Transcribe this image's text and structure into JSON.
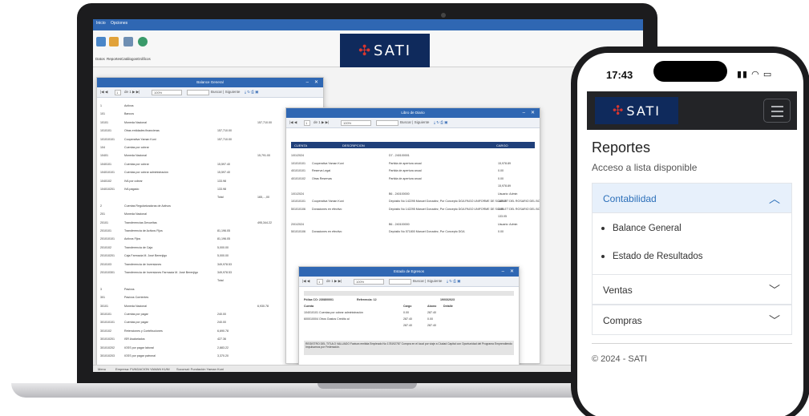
{
  "laptop": {
    "ribbon": {
      "tabs": [
        "Inicio",
        "Opciones"
      ],
      "buttons": [
        {
          "label": "Datos",
          "icon": "data-icon",
          "color": "#4a86c8"
        },
        {
          "label": "Reportes",
          "icon": "reports-icon",
          "color": "#e1a23a"
        },
        {
          "label": "Catálogos",
          "icon": "catalog-icon",
          "color": "#6f8fb3"
        },
        {
          "label": "Gráficos",
          "icon": "chart-icon",
          "color": "#3a9a6a"
        }
      ]
    },
    "logo": {
      "text": "SATI"
    },
    "balance_window": {
      "title": "Balance General",
      "zoom": "100%",
      "search_placeholder": "Buscar | Siguiente",
      "page": "1",
      "rows": [
        [
          "1",
          "Activos",
          "",
          ""
        ],
        [
          "101",
          "Bancos",
          "",
          ""
        ],
        [
          "10101",
          "Moneda Nacional",
          "",
          "157,710.00"
        ],
        [
          "1010101",
          "Otras entidades financieras",
          "157,710.00",
          ""
        ],
        [
          "101010101",
          "Cooperativa Yaman Kuni",
          "157,710.00",
          ""
        ],
        [
          "104",
          "Cuentas por cobrar",
          "",
          ""
        ],
        [
          "10401",
          "Moneda Nacional",
          "",
          "15,791.00"
        ],
        [
          "1040101",
          "Cuentas por cobrar",
          "15,597.40",
          ""
        ],
        [
          "104010101",
          "Cuentas por cobrar administración",
          "15,597.40",
          ""
        ],
        [
          "1040102",
          "IVA por cobrar",
          "133.98",
          ""
        ],
        [
          "104010201",
          "IVA pagado",
          "133.98",
          ""
        ],
        [
          "",
          "",
          "Total",
          "165,...,00"
        ],
        [
          "2",
          "Cuentas Regularizadoras de Activos",
          "",
          ""
        ],
        [
          "201",
          "Moneda Nacional",
          "",
          ""
        ],
        [
          "20101",
          "Transferencias Devueltas",
          "",
          "495,344.22"
        ],
        [
          "2010101",
          "Transferencia de Activos Fijos",
          "81,196.05",
          ""
        ],
        [
          "201010101",
          "Activos Fijos",
          "81,196.05",
          ""
        ],
        [
          "2010102",
          "Transferencia de Caja",
          "5,000.00",
          ""
        ],
        [
          "201010201",
          "Caja Farmacia M. José Berenjigo",
          "5,000.00",
          ""
        ],
        [
          "2010103",
          "Transferencia de Inversiones",
          "349,978.53",
          ""
        ],
        [
          "201010301",
          "Transferencia de Inversiones Farmacia M. José Berenjigo",
          "349,978.53",
          ""
        ],
        [
          "",
          "",
          "Total",
          ""
        ],
        [
          "3",
          "Pasivos",
          "",
          ""
        ],
        [
          "301",
          "Pasivos Corrientes",
          "",
          ""
        ],
        [
          "30101",
          "Moneda Nacional",
          "",
          "6,930.78"
        ],
        [
          "3010101",
          "Cuentas por pagar",
          "240.00",
          ""
        ],
        [
          "301010101",
          "Cuentas por pagar",
          "240.00",
          ""
        ],
        [
          "3010102",
          "Retenciones y Contribuciones",
          "6,690.78",
          ""
        ],
        [
          "301010201",
          "ISR Asalariados",
          "427.36",
          ""
        ],
        [
          "301010202",
          "IGSS por pagar laboral",
          "2,883.22",
          ""
        ],
        [
          "301010203",
          "IGSS por pagar patronal",
          "3,370.20",
          ""
        ]
      ]
    },
    "diary_window": {
      "title": "Libro de Diario",
      "zoom": "100%",
      "search_placeholder": "Buscar | Siguiente",
      "page": "1",
      "columns": [
        "CUENTA",
        "DESCRIPCION",
        "CARGO"
      ],
      "rows": [
        [
          "1/01/2024",
          "",
          "D7 - 240100001",
          ""
        ],
        [
          "101010101",
          "Cooperativa Yaman Kuni",
          "Partida de apertura anual",
          "15,978.89"
        ],
        [
          "401010101",
          "Reserva Legal",
          "Partida de apertura anual",
          "0.00"
        ],
        [
          "401010102",
          "Otras Reservas",
          "Partida de apertura anual",
          "0.00"
        ],
        [
          "",
          "",
          "",
          "15,978.89"
        ],
        [
          "1/01/2024",
          "",
          "B6 - 240100000",
          "Usuario: Admin"
        ],
        [
          "101010101",
          "Cooperativa Yaman Kuni",
          "Depósito No 142295 Manuel Gonzalez, Por Concepto DGA PAGO UNIFORME DE SCARLET DEL ROSARIO DEL BOSQUE MENDOZA C142295",
          "133.05"
        ],
        [
          "501010106",
          "Donaciones en efectivo",
          "Depósito No 142295 Manuel Gonzalez, Por Concepto DGA PAGO UNIFORME DE SCARLET DEL ROSARIO DEL BOSQUE MENDOZA C142295",
          "0.00"
        ],
        [
          "",
          "",
          "",
          "133.05"
        ],
        [
          "2/01/2024",
          "",
          "B6 - 240100000",
          "Usuario: Admin"
        ],
        [
          "501010106",
          "Donaciones en efectivo",
          "Depósito No 571800 Manuel Gonzalez, Por Concepto DGA",
          "0.00"
        ]
      ]
    },
    "expenses_window": {
      "title": "Estado de Egresos",
      "zoom": "100%",
      "search_placeholder": "Buscar | Siguiente",
      "page": "1",
      "policy": "Póliza CO: 230800001",
      "reference": "Referencia: 12",
      "date": "19/03/2023",
      "columns": [
        "Cuenta",
        "Cargo",
        "Abono",
        "Detalle"
      ],
      "rows": [
        [
          "104010101 Cuentas por cobrar administración",
          "0.00",
          "287.40"
        ],
        [
          "600010004 Otros Gastos Crédito al",
          "287.40",
          "0.00"
        ],
        [
          "",
          "287.40",
          "287.40"
        ]
      ],
      "note": "REGISTRO DEL TITULO VALUADO Factura emitida Empleado No 178192787 Compra en el local por viaje a Ciudad Capital con Oportunidad del Programa Emprendiendo Impulsamos por Federación."
    },
    "statusbar": {
      "left": "Menu",
      "company": "Empresa: FUNDACION YAMAN KUNI",
      "branch": "Sucursal: Fundación Yaman Kuni",
      "right": "7/05/2024 10:34:53"
    }
  },
  "phone": {
    "time": "17:43",
    "status_icons": "signal-icon wifi-icon battery-icon",
    "logo": {
      "text": "SATI"
    },
    "title": "Reportes",
    "subtitle": "Acceso a lista disponible",
    "accordion": [
      {
        "label": "Contabilidad",
        "open": true,
        "items": [
          "Balance General",
          "Estado de Resultados"
        ]
      },
      {
        "label": "Ventas",
        "open": false,
        "items": []
      },
      {
        "label": "Compras",
        "open": false,
        "items": []
      }
    ],
    "footer": "© 2024 - SATI",
    "colors": {
      "accent": "#2b6fb9",
      "navbar": "#232427",
      "logo_bg": "#0f2a5c",
      "logo_mark": "#d8362f"
    }
  }
}
